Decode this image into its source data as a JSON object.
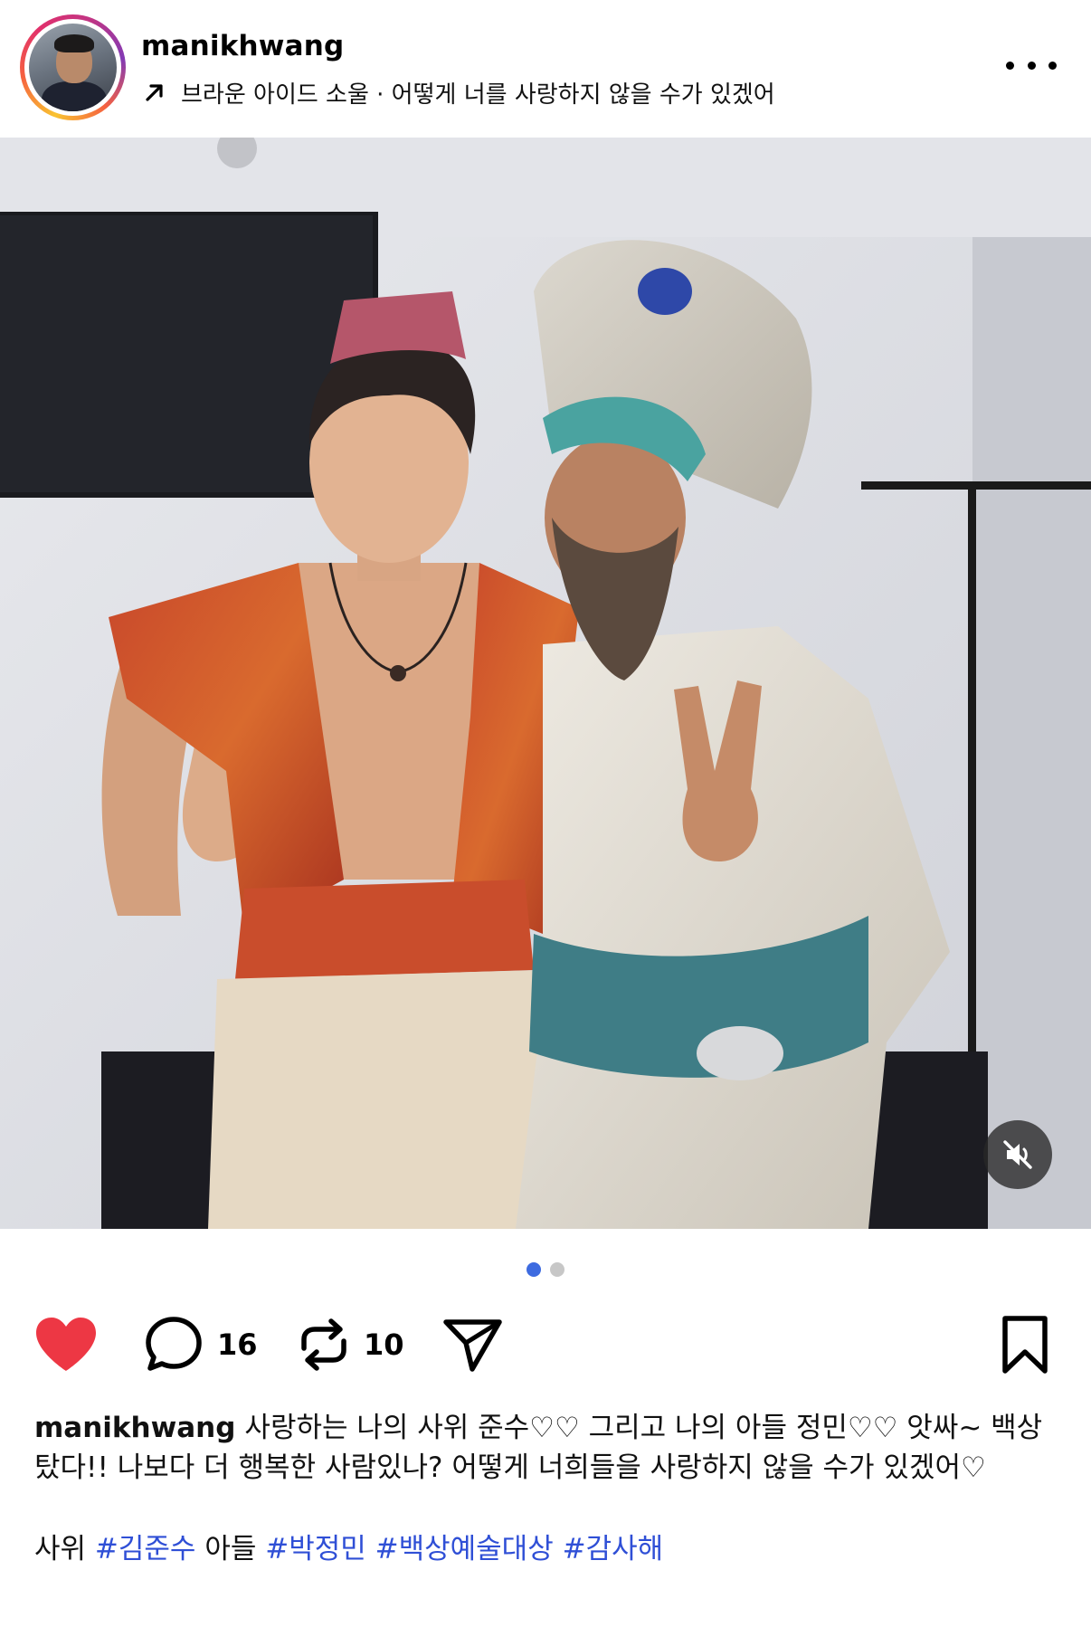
{
  "header": {
    "username": "manikhwang",
    "audio_text": "브라운 아이드 소울 · 어떻게 너를 사랑하지 않을 수가 있겠어",
    "avatar_alt": "profile-photo"
  },
  "icons": {
    "audio": "arrow-up-right-icon",
    "more": "more-horizontal-icon",
    "like": "heart-icon",
    "comment": "comment-bubble-icon",
    "repost": "repost-icon",
    "share": "send-icon",
    "save": "bookmark-icon",
    "mute": "speaker-muted-icon"
  },
  "colors": {
    "like": "#ed3744",
    "hashtag": "#2f4fd6",
    "active_dot": "#3d6be0"
  },
  "carousel": {
    "total": 2,
    "active_index": 0
  },
  "actions": {
    "liked": true,
    "comments_count": "16",
    "reposts_count": "10"
  },
  "caption": {
    "username": "manikhwang",
    "text": "사랑하는 나의 사위 준수♡♡ 그리고 나의 아들 정민♡♡ 앗싸~ 백상 탔다!! 나보다 더 행복한 사람있나? 어떻게 너희들을 사랑하지 않을 수가 있겠어♡",
    "line2_prefix_1": "사위",
    "tag_1": "#김준수",
    "line2_prefix_2": "아들",
    "tag_2": "#박정민",
    "tag_3": "#백상예술대상",
    "tag_4": "#감사해"
  }
}
